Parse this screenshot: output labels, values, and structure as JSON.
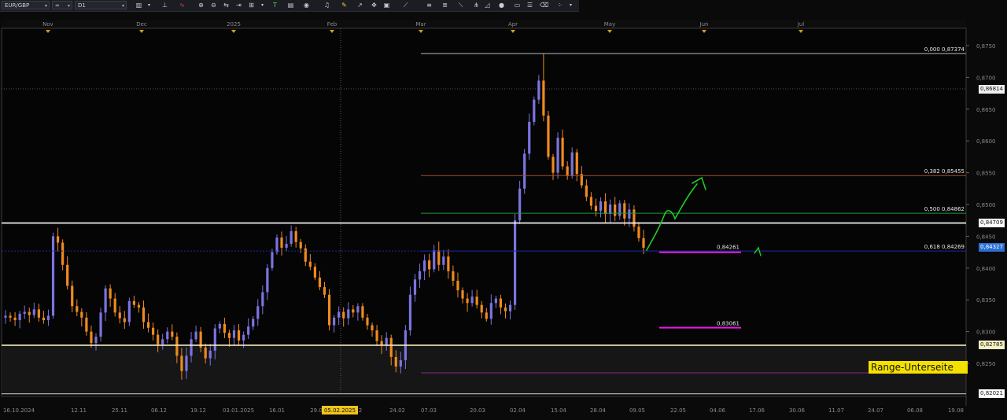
{
  "toolbar": {
    "symbol": "EUR/GBP",
    "link_icon": "link-icon",
    "timeframe": "D1"
  },
  "colors": {
    "bull": "#7b74e0",
    "bear": "#ef8a1f",
    "fib_0": "#b9b9c9",
    "fib_382": "#a34d2d",
    "fib_500": "#1f9a3a",
    "fib_618": "#1d2aa8",
    "magenta": "#e61be6",
    "green_arrow": "#22cc22",
    "white_line": "#ffffff",
    "yellow_line": "#f5f0c0",
    "current_price": "#2b6fd6"
  },
  "top_axis": {
    "months": [
      "Nov",
      "Dec",
      "2025",
      "Feb",
      "Mar",
      "Apr",
      "May",
      "Jun",
      "Jul"
    ]
  },
  "bottom_axis": {
    "dates": [
      "16.10.2024",
      "12.11",
      "25.11",
      "06.12",
      "19.12",
      "03.01.2025",
      "16.01",
      "29.0",
      "05.02.2025",
      "2",
      "24.02",
      "07.03",
      "20.03",
      "02.04",
      "15.04",
      "28.04",
      "09.05",
      "22.05",
      "04.06",
      "17.06",
      "30.06",
      "11.07",
      "24.07",
      "06.08",
      "19.08"
    ]
  },
  "price_axis": {
    "ticks": [
      "0,8750",
      "0,8700",
      "0,8650",
      "0,8600",
      "0,8550",
      "0,8500",
      "0,8450",
      "0,8400",
      "0,8350",
      "0,8300",
      "0,8250"
    ],
    "badges": {
      "high": "0,86814",
      "white": "0,84709",
      "current": "0,84327",
      "yellow": "0,82785",
      "bottom": "0,82021"
    }
  },
  "fib_labels": {
    "f0": "0,000 0,87374",
    "f382": "0,382 0,85455",
    "f500": "0,500 0,84862",
    "f618": "0,618 0,84269"
  },
  "level_labels": {
    "magenta_upper": "0,84261",
    "magenta_lower": "0,83061"
  },
  "range_label": "Range-Unterseite",
  "chart_data": {
    "type": "candlestick",
    "symbol": "EUR/GBP",
    "timeframe": "D1",
    "ylim": [
      0.8202,
      0.8767
    ],
    "fib_levels": [
      {
        "ratio": "0,000",
        "price": 0.87374
      },
      {
        "ratio": "0,382",
        "price": 0.85455
      },
      {
        "ratio": "0,500",
        "price": 0.84862
      },
      {
        "ratio": "0,618",
        "price": 0.84269
      }
    ],
    "horizontal_levels": [
      0.86814,
      0.84709,
      0.84261,
      0.83061,
      0.82785,
      0.82021
    ],
    "current_price": 0.84327,
    "close_series": [
      0.8325,
      0.8322,
      0.8318,
      0.8328,
      0.8331,
      0.8326,
      0.8335,
      0.8322,
      0.8318,
      0.8325,
      0.845,
      0.844,
      0.8405,
      0.8372,
      0.834,
      0.8331,
      0.8322,
      0.83,
      0.8282,
      0.8292,
      0.833,
      0.8368,
      0.8352,
      0.833,
      0.8321,
      0.8315,
      0.8348,
      0.8342,
      0.8338,
      0.8315,
      0.8306,
      0.8295,
      0.828,
      0.8288,
      0.83,
      0.8292,
      0.8262,
      0.8238,
      0.8262,
      0.8288,
      0.83,
      0.8275,
      0.8258,
      0.827,
      0.8305,
      0.8312,
      0.8298,
      0.829,
      0.8302,
      0.8286,
      0.8295,
      0.8308,
      0.832,
      0.834,
      0.8362,
      0.84,
      0.8425,
      0.8448,
      0.8432,
      0.8438,
      0.8458,
      0.8441,
      0.8431,
      0.841,
      0.8402,
      0.8385,
      0.837,
      0.8358,
      0.831,
      0.8322,
      0.8331,
      0.8321,
      0.8335,
      0.833,
      0.834,
      0.8322,
      0.831,
      0.8302,
      0.8285,
      0.8278,
      0.829,
      0.826,
      0.8245,
      0.8255,
      0.8302,
      0.8358,
      0.8382,
      0.8395,
      0.8412,
      0.8398,
      0.8428,
      0.8405,
      0.8418,
      0.8395,
      0.838,
      0.8365,
      0.8352,
      0.8345,
      0.8355,
      0.8342,
      0.833,
      0.832,
      0.8345,
      0.8352,
      0.8338,
      0.8332,
      0.8342,
      0.8475,
      0.8525,
      0.858,
      0.863,
      0.8665,
      0.8695,
      0.864,
      0.8575,
      0.855,
      0.8605,
      0.856,
      0.8545,
      0.8582,
      0.8548,
      0.853,
      0.8512,
      0.8498,
      0.849,
      0.8505,
      0.8485,
      0.85,
      0.8482,
      0.8502,
      0.8478,
      0.8492,
      0.8465,
      0.8447,
      0.8432
    ]
  }
}
